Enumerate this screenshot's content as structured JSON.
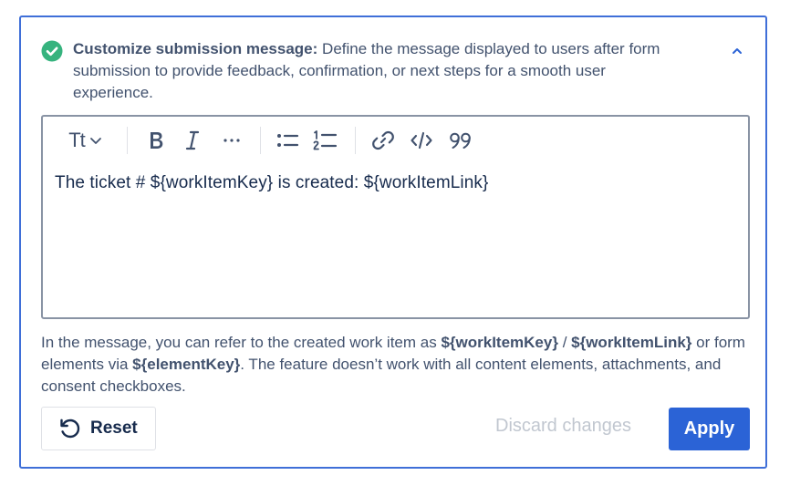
{
  "header": {
    "title_bold": "Customize submission message:",
    "title_rest": " Define the message displayed to users after form submission to provide feedback, confirmation, or next steps for a smooth user experience.",
    "status_icon": "check-circle-icon",
    "collapse_icon": "chevron-up-icon"
  },
  "editor": {
    "toolbar": {
      "text_style_label": "Tt",
      "text_style_icon": "chevron-down-icon",
      "bold_icon": "bold-icon",
      "italic_icon": "italic-icon",
      "more_icon": "more-icon",
      "bullet_list_icon": "bullet-list-icon",
      "numbered_list_icon": "numbered-list-icon",
      "link_icon": "link-icon",
      "code_icon": "code-icon",
      "quote_icon": "quote-icon"
    },
    "content": "The ticket # ${workItemKey} is created: ${workItemLink}"
  },
  "help": {
    "part1": "In the message, you can refer to the created work item as ",
    "var1": "${workItemKey}",
    "part2": " / ",
    "var2": "${workItemLink}",
    "part3": " or form elements via ",
    "var3": "${elementKey}",
    "part4": ". The feature doesn’t work with all content elements, attachments, and consent checkboxes."
  },
  "actions": {
    "reset_label": "Reset",
    "reset_icon": "undo-icon",
    "discard_label": "Discard changes",
    "apply_label": "Apply"
  },
  "colors": {
    "accent": "#2b63d6",
    "success": "#36b37e",
    "border_active": "#3f6fd8",
    "disabled_text": "#c1c7d0"
  }
}
